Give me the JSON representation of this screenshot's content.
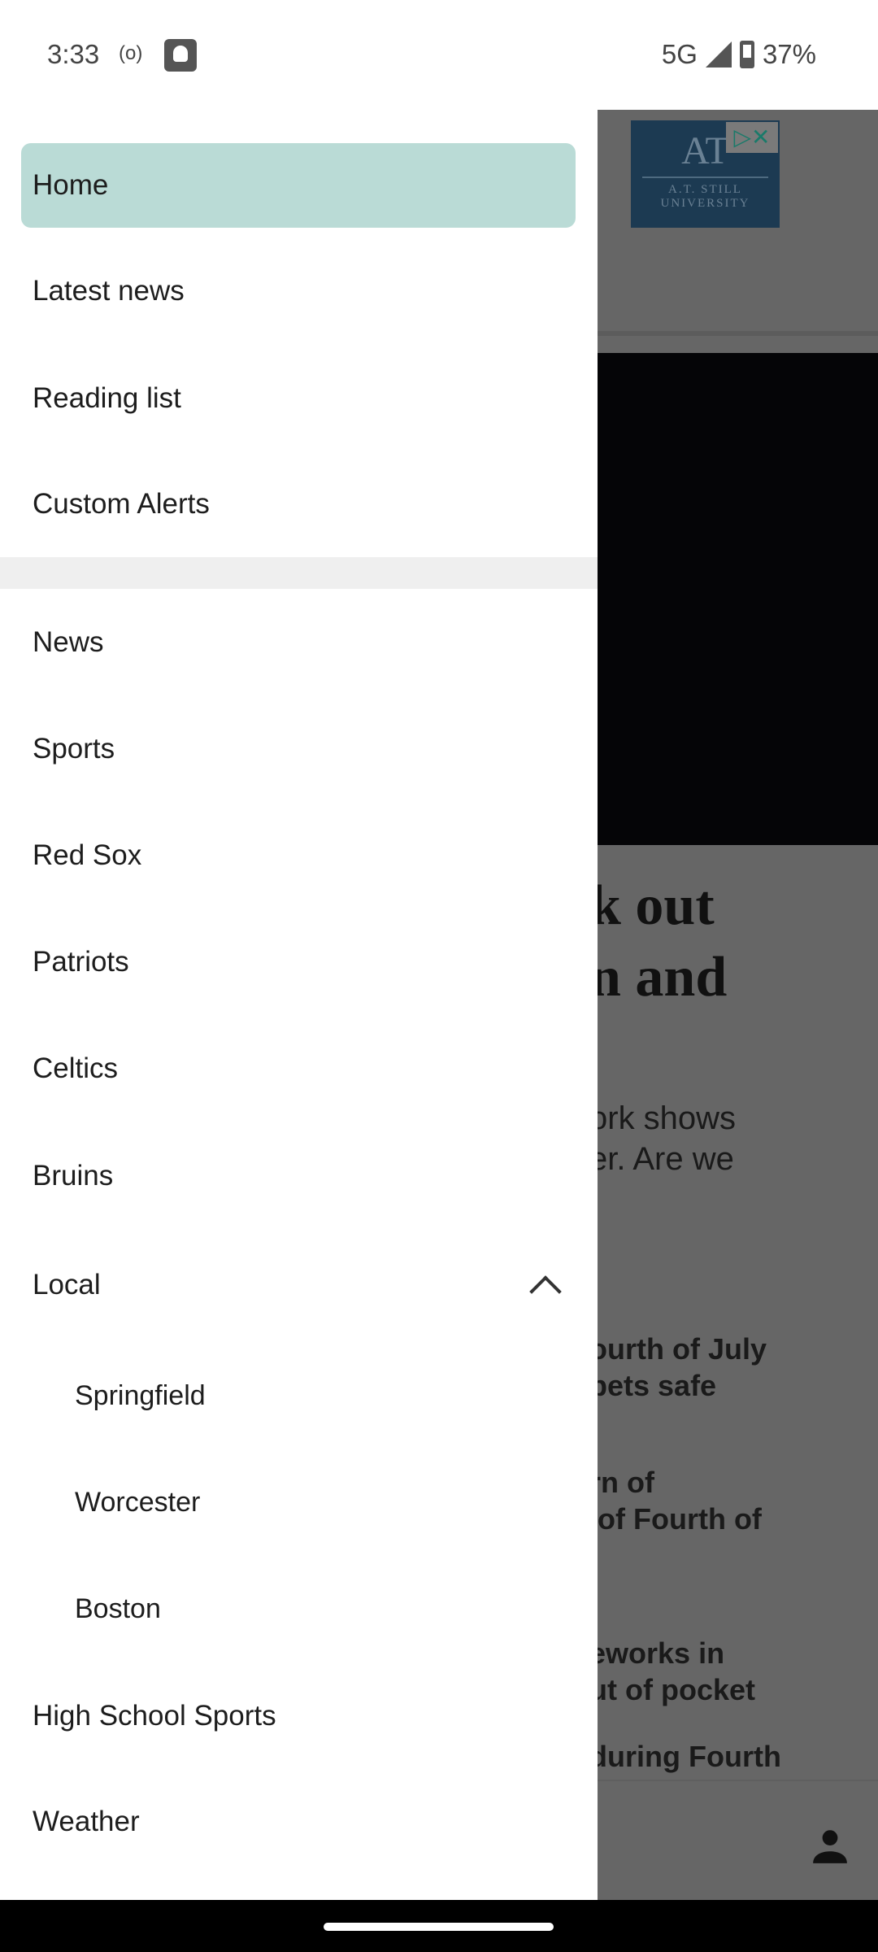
{
  "status_bar": {
    "time": "3:33",
    "network": "5G",
    "battery": "37%",
    "icons": [
      "cast-icon",
      "app-notification-icon",
      "signal-icon",
      "battery-icon"
    ]
  },
  "drawer": {
    "top_items": [
      {
        "label": "Home",
        "active": true
      },
      {
        "label": "Latest news"
      },
      {
        "label": "Reading list"
      },
      {
        "label": "Custom Alerts"
      }
    ],
    "sections": [
      {
        "label": "News"
      },
      {
        "label": "Sports"
      },
      {
        "label": "Red Sox"
      },
      {
        "label": "Patriots"
      },
      {
        "label": "Celtics"
      },
      {
        "label": "Bruins"
      },
      {
        "label": "Local",
        "expanded": true
      }
    ],
    "local_sub": [
      {
        "label": "Springfield"
      },
      {
        "label": "Worcester"
      },
      {
        "label": "Boston"
      }
    ],
    "bottom_items": [
      {
        "label": "High School Sports"
      },
      {
        "label": "Weather"
      }
    ],
    "active_color": "#badbd6"
  },
  "background": {
    "ad": {
      "title": "AT",
      "subtitle": "A.T. STILL UNIVERSITY"
    },
    "headline": "k out\nn and",
    "summary": "ork shows\ner. Are we",
    "links": [
      "ourth of July\npets safe",
      "rn of\n of Fourth of",
      "eworks in\nut of pocket",
      "during Fourth"
    ]
  }
}
